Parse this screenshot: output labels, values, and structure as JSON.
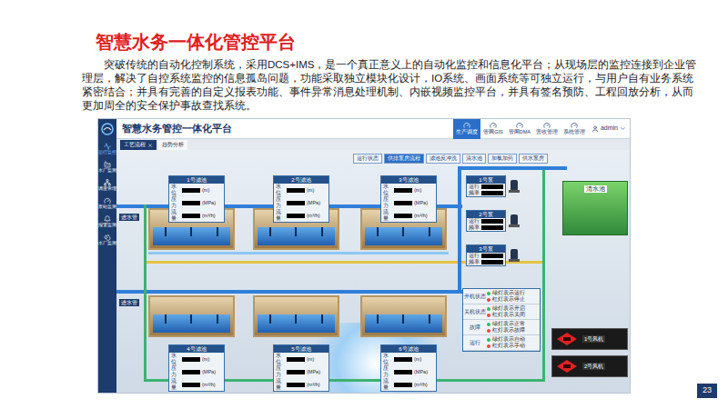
{
  "slide": {
    "title": "智慧水务一体化管控平台",
    "body": "突破传统的自动化控制系统，采用DCS+IMS，是一个真正意义上的自动化监控和信息化平台；从现场层的监控连接到企业管理层，解决了自控系统监控的信息孤岛问题，功能采取独立模块化设计，IO系统、画面系统等可独立运行，与用户自有业务系统紧密结合；并具有完善的自定义报表功能、事件异常消息处理机制、内嵌视频监控平台，并具有签名预防、工程回放分析，从而更加周全的安全保护事故查找系统。",
    "page": "23"
  },
  "app": {
    "title": "智慧水务管控一体化平台",
    "nav": [
      {
        "label": "生产调度",
        "selected": true
      },
      {
        "label": "管网GIS",
        "selected": false
      },
      {
        "label": "管网DMA",
        "selected": false
      },
      {
        "label": "营收管理",
        "selected": false
      },
      {
        "label": "系统管理",
        "selected": false
      }
    ],
    "user": "admin",
    "sidebar": [
      {
        "label": "运行监控",
        "selected": true
      },
      {
        "label": "水厂监测",
        "selected": false
      },
      {
        "label": "调度管理",
        "selected": false
      },
      {
        "label": "泵站监测",
        "selected": false
      },
      {
        "label": "报警监测",
        "selected": false
      },
      {
        "label": "水厂监测",
        "selected": false
      }
    ],
    "tabs": [
      {
        "label": "工艺流程",
        "selected": true
      },
      {
        "label": "趋势分析",
        "selected": false
      }
    ],
    "toolbar": [
      {
        "label": "运行状态",
        "selected": false
      },
      {
        "label": "供排泵房流程",
        "selected": true
      },
      {
        "label": "滤池反冲洗",
        "selected": false
      },
      {
        "label": "清水池",
        "selected": false
      },
      {
        "label": "加氯加药",
        "selected": false
      },
      {
        "label": "供水泵房",
        "selected": false
      }
    ],
    "meter_rows": [
      {
        "label": "水位",
        "unit": "(m)"
      },
      {
        "label": "压力",
        "unit": "(MPa)"
      },
      {
        "label": "流量",
        "unit": "(m³/h)"
      }
    ],
    "filters": [
      {
        "name": "1号滤池"
      },
      {
        "name": "2号滤池"
      },
      {
        "name": "3号滤池"
      },
      {
        "name": "4号滤池"
      },
      {
        "name": "5号滤池"
      },
      {
        "name": "6号滤池"
      }
    ],
    "inlets": [
      "进水管",
      "进水管"
    ],
    "pump_rows": [
      "运行",
      "频率"
    ],
    "pumps": [
      {
        "name": "1号泵"
      },
      {
        "name": "2号泵"
      },
      {
        "name": "3号泵"
      }
    ],
    "clear_well": "清水池",
    "status_panel": [
      {
        "group": "开机状态",
        "items": [
          {
            "label": "绿灯表示运行",
            "color": "#22c55e"
          },
          {
            "label": "红灯表示停止",
            "color": "#ef4444"
          }
        ]
      },
      {
        "group": "关机状态",
        "items": [
          {
            "label": "绿灯表示开启",
            "color": "#22c55e"
          },
          {
            "label": "红灯表示关闭",
            "color": "#ef4444"
          }
        ]
      },
      {
        "group": "故障",
        "items": [
          {
            "label": "绿灯表示正常",
            "color": "#22c55e"
          },
          {
            "label": "红灯表示故障",
            "color": "#ef4444"
          }
        ]
      },
      {
        "group": "运行",
        "items": [
          {
            "label": "绿灯表示自动",
            "color": "#22c55e"
          },
          {
            "label": "红灯表示手动",
            "color": "#ef4444"
          }
        ]
      }
    ],
    "fans": [
      {
        "name": "1号风机"
      },
      {
        "name": "2号风机"
      }
    ]
  }
}
